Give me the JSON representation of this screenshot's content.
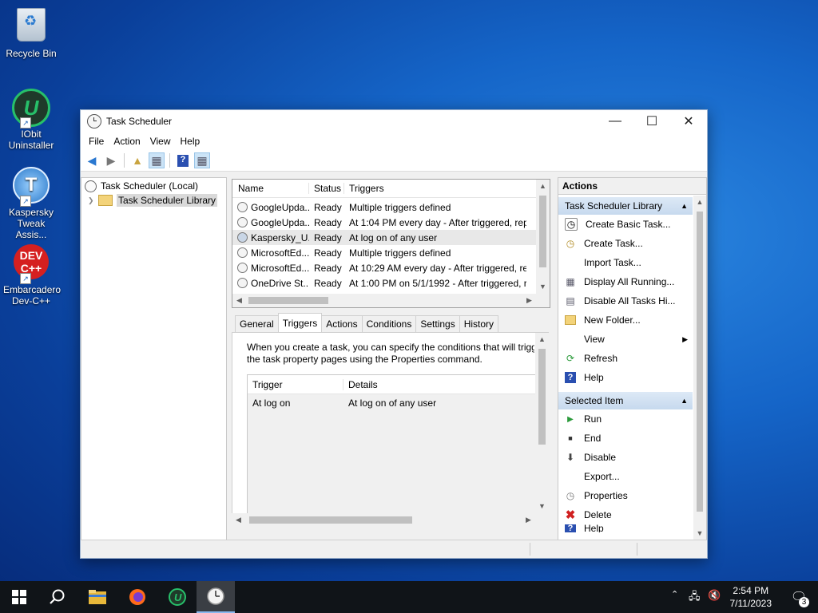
{
  "desktop": {
    "icons": [
      {
        "label": "Recycle Bin"
      },
      {
        "label": "IObit Uninstaller"
      },
      {
        "label": "Kaspersky Tweak Assis..."
      },
      {
        "label": "Embarcadero Dev-C++"
      }
    ]
  },
  "window": {
    "title": "Task Scheduler",
    "menu": [
      "File",
      "Action",
      "View",
      "Help"
    ]
  },
  "tree": {
    "root": "Task Scheduler (Local)",
    "library": "Task Scheduler Library"
  },
  "tasklist": {
    "headers": [
      "Name",
      "Status",
      "Triggers"
    ],
    "rows": [
      {
        "name": "GoogleUpda...",
        "status": "Ready",
        "trigger": "Multiple triggers defined"
      },
      {
        "name": "GoogleUpda...",
        "status": "Ready",
        "trigger": "At 1:04 PM every day - After triggered, repe"
      },
      {
        "name": "Kaspersky_U...",
        "status": "Ready",
        "trigger": "At log on of any user"
      },
      {
        "name": "MicrosoftEd...",
        "status": "Ready",
        "trigger": "Multiple triggers defined"
      },
      {
        "name": "MicrosoftEd...",
        "status": "Ready",
        "trigger": "At 10:29 AM every day - After triggered, rep"
      },
      {
        "name": "OneDrive St...",
        "status": "Ready",
        "trigger": "At 1:00 PM on 5/1/1992 - After triggered, re"
      }
    ],
    "selected_index": 2
  },
  "detail": {
    "tabs": [
      "General",
      "Triggers",
      "Actions",
      "Conditions",
      "Settings",
      "History"
    ],
    "active_tab": "Triggers",
    "info_line1": "When you create a task, you can specify the conditions that will trigg",
    "info_line2": "the task property pages using the Properties command.",
    "table_headers": [
      "Trigger",
      "Details"
    ],
    "rows": [
      {
        "trigger": "At log on",
        "details": "At log on of any user"
      }
    ]
  },
  "actions": {
    "title": "Actions",
    "section1": "Task Scheduler Library",
    "items1": [
      {
        "label": "Create Basic Task...",
        "icon": "create-basic-task-icon"
      },
      {
        "label": "Create Task...",
        "icon": "create-task-icon"
      },
      {
        "label": "Import Task...",
        "icon": ""
      },
      {
        "label": "Display All Running...",
        "icon": "display-running-icon"
      },
      {
        "label": "Disable All Tasks Hi...",
        "icon": "disable-history-icon"
      },
      {
        "label": "New Folder...",
        "icon": "folder-icon"
      },
      {
        "label": "View",
        "icon": ""
      },
      {
        "label": "Refresh",
        "icon": "refresh-icon"
      },
      {
        "label": "Help",
        "icon": "help-icon"
      }
    ],
    "section2": "Selected Item",
    "items2": [
      {
        "label": "Run",
        "icon": "run-icon"
      },
      {
        "label": "End",
        "icon": "end-icon"
      },
      {
        "label": "Disable",
        "icon": "disable-icon"
      },
      {
        "label": "Export...",
        "icon": ""
      },
      {
        "label": "Properties",
        "icon": "properties-icon"
      },
      {
        "label": "Delete",
        "icon": "delete-icon"
      },
      {
        "label": "Help",
        "icon": "help-icon"
      }
    ]
  },
  "taskbar": {
    "time": "2:54 PM",
    "date": "7/11/2023",
    "notifications": "3"
  },
  "colors": {
    "section_header": "#c6d9ee",
    "selection": "#e8e8e8",
    "taskbar": "#101418"
  }
}
